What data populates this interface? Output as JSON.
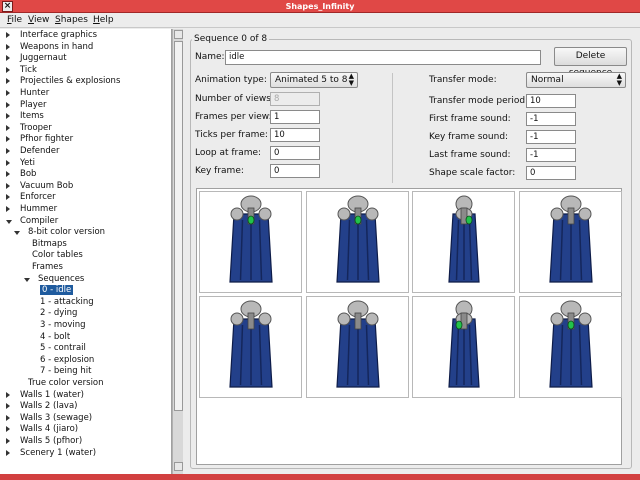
{
  "window": {
    "title": "Shapes_Infinity"
  },
  "menu": [
    {
      "underline": "F",
      "rest": "ile"
    },
    {
      "underline": "V",
      "rest": "iew"
    },
    {
      "underline": "S",
      "rest": "hapes"
    },
    {
      "underline": "H",
      "rest": "elp"
    }
  ],
  "tree": [
    {
      "label": "Interface graphics",
      "state": "closed",
      "level": 0
    },
    {
      "label": "Weapons in hand",
      "state": "closed",
      "level": 0
    },
    {
      "label": "Juggernaut",
      "state": "closed",
      "level": 0
    },
    {
      "label": "Tick",
      "state": "closed",
      "level": 0
    },
    {
      "label": "Projectiles & explosions",
      "state": "closed",
      "level": 0
    },
    {
      "label": "Hunter",
      "state": "closed",
      "level": 0
    },
    {
      "label": "Player",
      "state": "closed",
      "level": 0
    },
    {
      "label": "Items",
      "state": "closed",
      "level": 0
    },
    {
      "label": "Trooper",
      "state": "closed",
      "level": 0
    },
    {
      "label": "Pfhor fighter",
      "state": "closed",
      "level": 0
    },
    {
      "label": "Defender",
      "state": "closed",
      "level": 0
    },
    {
      "label": "Yeti",
      "state": "closed",
      "level": 0
    },
    {
      "label": "Bob",
      "state": "closed",
      "level": 0
    },
    {
      "label": "Vacuum Bob",
      "state": "closed",
      "level": 0
    },
    {
      "label": "Enforcer",
      "state": "closed",
      "level": 0
    },
    {
      "label": "Hummer",
      "state": "closed",
      "level": 0
    },
    {
      "label": "Compiler",
      "state": "open",
      "level": 0
    },
    {
      "label": "8-bit color version",
      "state": "open",
      "level": 1
    },
    {
      "label": "Bitmaps",
      "state": "none",
      "level": 2
    },
    {
      "label": "Color tables",
      "state": "none",
      "level": 2
    },
    {
      "label": "Frames",
      "state": "none",
      "level": 2
    },
    {
      "label": "Sequences",
      "state": "open",
      "level": 2
    },
    {
      "label": "0 - idle",
      "state": "none",
      "level": 3,
      "selected": true
    },
    {
      "label": "1 - attacking",
      "state": "none",
      "level": 3
    },
    {
      "label": "2 - dying",
      "state": "none",
      "level": 3
    },
    {
      "label": "3 - moving",
      "state": "none",
      "level": 3
    },
    {
      "label": "4 - bolt",
      "state": "none",
      "level": 3
    },
    {
      "label": "5 - contrail",
      "state": "none",
      "level": 3
    },
    {
      "label": "6 - explosion",
      "state": "none",
      "level": 3
    },
    {
      "label": "7 - being hit",
      "state": "none",
      "level": 3
    },
    {
      "label": "True color version",
      "state": "none",
      "level": 1
    },
    {
      "label": "Walls 1 (water)",
      "state": "closed",
      "level": 0
    },
    {
      "label": "Walls 2 (lava)",
      "state": "closed",
      "level": 0
    },
    {
      "label": "Walls 3 (sewage)",
      "state": "closed",
      "level": 0
    },
    {
      "label": "Walls 4 (jiaro)",
      "state": "closed",
      "level": 0
    },
    {
      "label": "Walls 5 (pfhor)",
      "state": "closed",
      "level": 0
    },
    {
      "label": "Scenery 1 (water)",
      "state": "closed",
      "level": 0
    }
  ],
  "sequence": {
    "group_title": "Sequence 0 of 8",
    "name_label": "Name:",
    "name_value": "idle",
    "delete_label": "Delete sequence",
    "animation_type_label": "Animation type:",
    "animation_type_value": "Animated 5 to 8",
    "num_views_label": "Number of views:",
    "num_views_value": "8",
    "frames_per_view_label": "Frames per view:",
    "frames_per_view_value": "1",
    "ticks_per_frame_label": "Ticks per frame:",
    "ticks_per_frame_value": "10",
    "loop_at_frame_label": "Loop at frame:",
    "loop_at_frame_value": "0",
    "key_frame_label": "Key frame:",
    "key_frame_value": "0",
    "transfer_mode_label": "Transfer mode:",
    "transfer_mode_value": "Normal",
    "transfer_mode_period_label": "Transfer mode period:",
    "transfer_mode_period_value": "10",
    "first_frame_sound_label": "First frame sound:",
    "first_frame_sound_value": "-1",
    "key_frame_sound_label": "Key frame sound:",
    "key_frame_sound_value": "-1",
    "last_frame_sound_label": "Last frame sound:",
    "last_frame_sound_value": "-1",
    "shape_scale_factor_label": "Shape scale factor:",
    "shape_scale_factor_value": "0"
  },
  "frames": [
    {
      "view": "front",
      "gem": true
    },
    {
      "view": "front-right",
      "gem": true
    },
    {
      "view": "right",
      "gem": true
    },
    {
      "view": "back-right",
      "gem": false
    },
    {
      "view": "back",
      "gem": false
    },
    {
      "view": "back-left",
      "gem": false
    },
    {
      "view": "left",
      "gem": true
    },
    {
      "view": "front-left",
      "gem": true
    }
  ],
  "colors": {
    "robe": "#23408a",
    "robe_dark": "#0e1c48",
    "metal": "#b8b8b8",
    "gem": "#23c24a",
    "selection": "#1f5b9e",
    "titlebar": "#e04846"
  }
}
